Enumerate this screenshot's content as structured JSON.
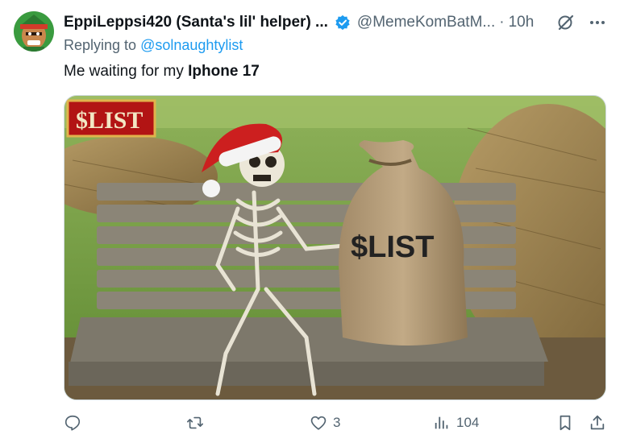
{
  "tweet": {
    "display_name": "EppiLeppsi420 (Santa's lil' helper) ...",
    "handle": "@MemeKomBatM...",
    "separator": "·",
    "time": "10h",
    "replying_prefix": "Replying to ",
    "replying_user": "@solnaughtylist",
    "text_plain": "Me waiting for my ",
    "text_bold": "Iphone 17",
    "media": {
      "banner_text": "$LIST",
      "bag_text": "$LIST"
    }
  },
  "actions": {
    "reply_count": "",
    "retweet_count": "",
    "like_count": "3",
    "views_count": "104"
  },
  "colors": {
    "accent": "#1d9bf0",
    "muted": "#536471",
    "text": "#0f1419"
  },
  "icons": {
    "verified": "verified-badge-icon",
    "grok": "grok-icon",
    "more": "more-icon",
    "reply": "reply-icon",
    "retweet": "retweet-icon",
    "like": "heart-icon",
    "views": "views-icon",
    "bookmark": "bookmark-icon",
    "share": "share-icon"
  }
}
